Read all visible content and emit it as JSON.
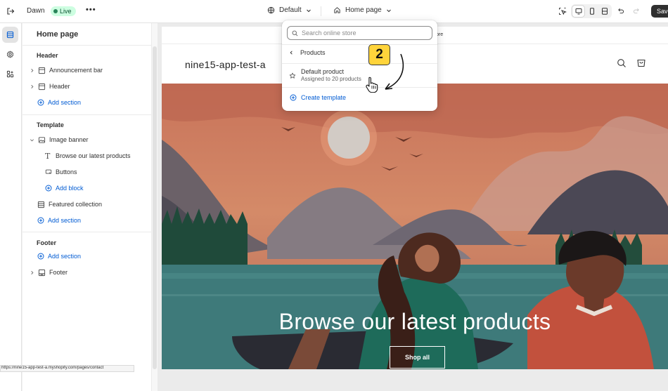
{
  "topbar": {
    "theme_name": "Dawn",
    "status_badge": "Live",
    "more_label": "•••",
    "theme_select_label": "Default",
    "page_select_label": "Home page",
    "save_label": "Save"
  },
  "sidebar": {
    "title": "Home page",
    "groups": [
      {
        "title": "Header",
        "items": [
          "Announcement bar",
          "Header"
        ],
        "add_label": "Add section"
      },
      {
        "title": "Template",
        "section": "Image banner",
        "blocks": [
          "Browse our latest products",
          "Buttons"
        ],
        "add_block_label": "Add block",
        "items": [
          "Featured collection"
        ],
        "add_label": "Add section"
      },
      {
        "title": "Footer",
        "add_label": "Add section",
        "items": [
          "Footer"
        ]
      }
    ]
  },
  "dropdown": {
    "search_placeholder": "Search online store",
    "back_label": "Products",
    "template": {
      "title": "Default product",
      "subtitle": "Assigned to 20 products"
    },
    "create_label": "Create template"
  },
  "annotation": {
    "step_number": "2"
  },
  "preview": {
    "announcement_text": "ore",
    "store_name": "nine15-app-test-a",
    "hero_heading": "Browse our latest products",
    "hero_button": "Shop all"
  },
  "status_bar": {
    "url": "https://nine15-app-test-a.myshopify.com/pages/contact"
  },
  "colors": {
    "accent": "#005bd3",
    "live_bg": "#cdfee1",
    "badge": "#ffd43b"
  }
}
